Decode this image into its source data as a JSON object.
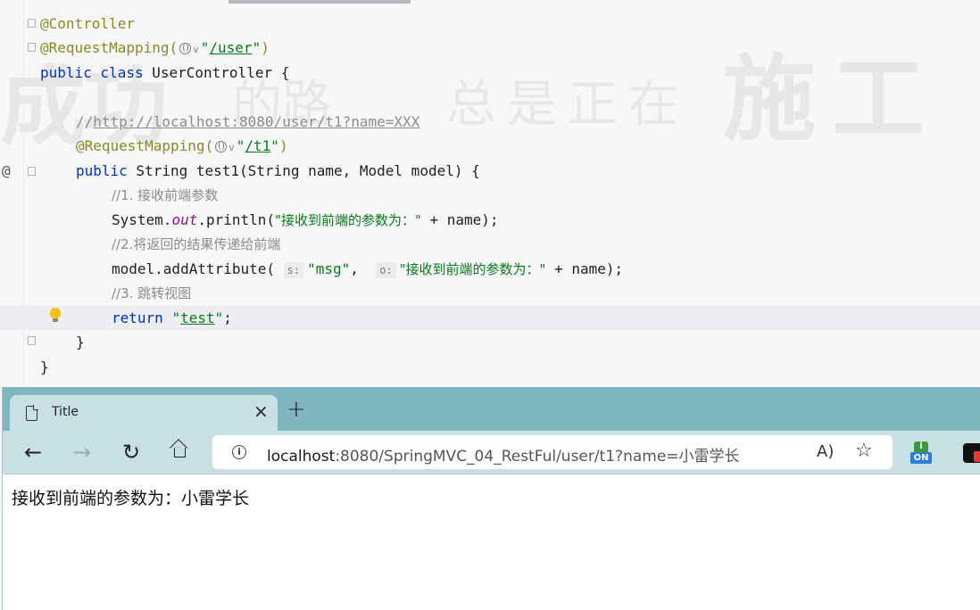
{
  "editor": {
    "watermark": [
      "成功",
      "的路",
      "总是正在",
      "施工"
    ],
    "lines": {
      "l1_annotation": "@Controller",
      "l2_annotation": "@RequestMapping(",
      "l2_path": "/user",
      "l3_public": "public class",
      "l3_name": " UserController {",
      "l5_comment": "http://localhost:8080/user/t1?name=XXX",
      "l6_annotation": "@RequestMapping(",
      "l6_path": "/t1",
      "l7_public": "public",
      "l7_rest": " String test1(String name, Model model) {",
      "l8_comment": "//1. 接收前端参数",
      "l9_prefix": "System.",
      "l9_field": "out",
      "l9_call": ".println(",
      "l9_string": "\"接收到前端的参数为：\"",
      "l9_suffix": " + name);",
      "l10_comment": "//2.将返回的结果传递给前端",
      "l11_prefix": "model.addAttribute(",
      "l11_hint1": "s:",
      "l11_arg1": "\"msg\"",
      "l11_sep": ", ",
      "l11_hint2": "o:",
      "l11_string": "\"接收到前端的参数为：\"",
      "l11_suffix": " + name);",
      "l12_comment": "//3. 跳转视图",
      "l13_return": "return",
      "l13_view": "test",
      "l14_close": "}",
      "l15_close": "}"
    },
    "gutter_marker": "@"
  },
  "browser": {
    "tab_title": "Title",
    "tab_close": "×",
    "new_tab": "+",
    "url_host": "localhost",
    "url_rest": ":8080/SpringMVC_04_RestFul/user/t1?name=小雷学长",
    "extension_badge": "ON",
    "page_text": "接收到前端的参数为：小雷学长",
    "colors": {
      "tabstrip": "#7fb6c0",
      "toolbar": "#c8e0e4"
    }
  }
}
